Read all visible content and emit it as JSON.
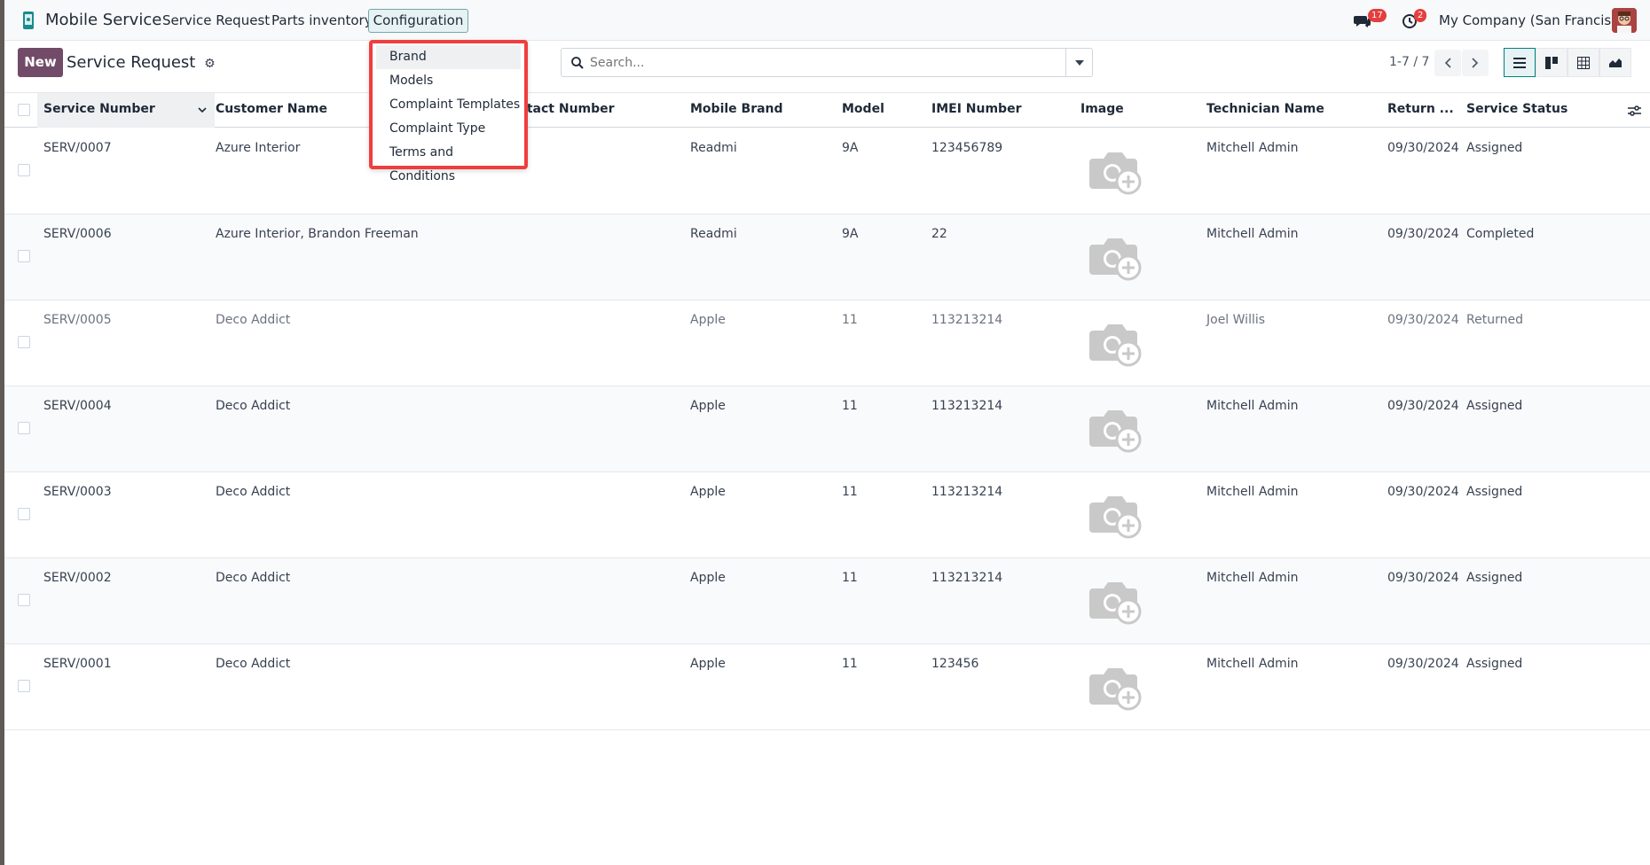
{
  "navbar": {
    "app_title": "Mobile Service",
    "menus": [
      "Service Request",
      "Parts inventory"
    ],
    "active_menu": "Configuration",
    "messages_count": "17",
    "activities_count": "2",
    "company": "My Company (San Francisco)"
  },
  "dropdown": {
    "items": [
      "Brand",
      "Models",
      "Complaint Templates",
      "Complaint Type",
      "Terms and Conditions"
    ]
  },
  "control_panel": {
    "new_label": "New",
    "breadcrumb": "Service Request",
    "search_placeholder": "Search...",
    "pager": "1-7 / 7"
  },
  "table": {
    "headers": [
      "Service Number",
      "Customer Name",
      "Contact Number",
      "Mobile Brand",
      "Model",
      "IMEI Number",
      "Image",
      "Technician Name",
      "Return ...",
      "Service Status"
    ],
    "rows": [
      {
        "number": "SERV/0007",
        "customer": "Azure Interior",
        "brand": "Readmi",
        "model": "9A",
        "imei": "123456789",
        "technician": "Mitchell Admin",
        "return_date": "09/30/2024",
        "status": "Assigned"
      },
      {
        "number": "SERV/0006",
        "customer": "Azure Interior, Brandon Freeman",
        "brand": "Readmi",
        "model": "9A",
        "imei": "22",
        "technician": "Mitchell Admin",
        "return_date": "09/30/2024",
        "status": "Completed"
      },
      {
        "number": "SERV/0005",
        "customer": "Deco Addict",
        "brand": "Apple",
        "model": "11",
        "imei": "113213214",
        "technician": "Joel Willis",
        "return_date": "09/30/2024",
        "status": "Returned"
      },
      {
        "number": "SERV/0004",
        "customer": "Deco Addict",
        "brand": "Apple",
        "model": "11",
        "imei": "113213214",
        "technician": "Mitchell Admin",
        "return_date": "09/30/2024",
        "status": "Assigned"
      },
      {
        "number": "SERV/0003",
        "customer": "Deco Addict",
        "brand": "Apple",
        "model": "11",
        "imei": "113213214",
        "technician": "Mitchell Admin",
        "return_date": "09/30/2024",
        "status": "Assigned"
      },
      {
        "number": "SERV/0002",
        "customer": "Deco Addict",
        "brand": "Apple",
        "model": "11",
        "imei": "113213214",
        "technician": "Mitchell Admin",
        "return_date": "09/30/2024",
        "status": "Assigned"
      },
      {
        "number": "SERV/0001",
        "customer": "Deco Addict",
        "brand": "Apple",
        "model": "11",
        "imei": "123456",
        "technician": "Mitchell Admin",
        "return_date": "09/30/2024",
        "status": "Assigned"
      }
    ]
  },
  "colors": {
    "brand_primary": "#714b67",
    "accent": "#017e84",
    "highlight_border": "#ef3e3e",
    "badge": "#e53e3e"
  },
  "icons": [
    "app-logo-icon",
    "messages-icon",
    "activity-clock-icon",
    "gear-icon",
    "search-icon",
    "caret-down-icon",
    "chevron-left-icon",
    "chevron-right-icon",
    "list-view-icon",
    "kanban-view-icon",
    "pivot-view-icon",
    "graph-view-icon",
    "column-settings-icon",
    "camera-add-icon"
  ]
}
